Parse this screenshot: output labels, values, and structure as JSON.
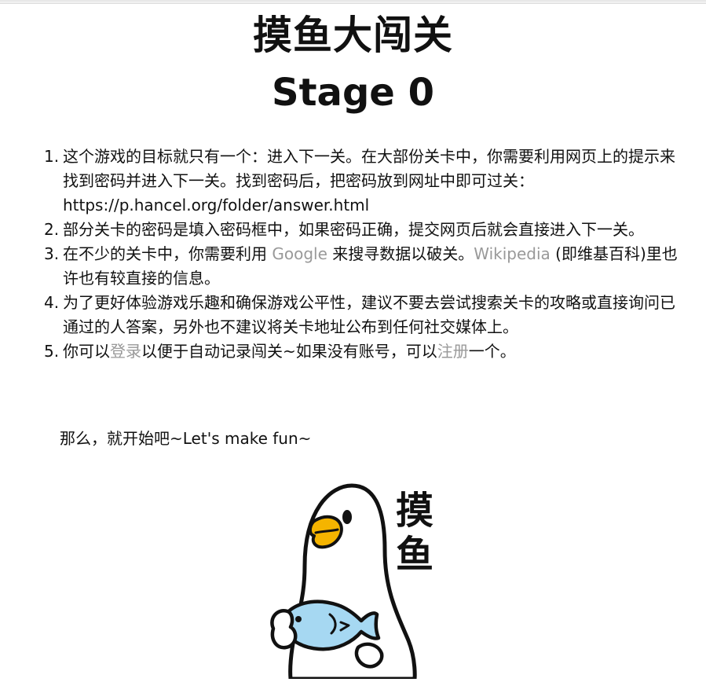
{
  "page": {
    "title": "摸鱼大闯关",
    "stage": "Stage 0"
  },
  "rules": [
    {
      "num": "1.",
      "text": "这个游戏的目标就只有一个：进入下一关。在大部份关卡中，你需要利用网页上的提示来找到密码并进入下一关。找到密码后，把密码放到网址中即可过关：https://p.hancel.org/folder/answer.html"
    },
    {
      "num": "2.",
      "text": "部分关卡的密码是填入密码框中，如果密码正确，提交网页后就会直接进入下一关。"
    },
    {
      "num": "3.",
      "pre": "在不少的关卡中，你需要利用 ",
      "link1": "Google",
      "mid": " 来搜寻数据以破关。",
      "link2": "Wikipedia",
      "post": " (即维基百科)里也许也有较直接的信息。"
    },
    {
      "num": "4.",
      "text": "为了更好体验游戏乐趣和确保游戏公平性，建议不要去尝试搜索关卡的攻略或直接询问已通过的人答案，另外也不建议将关卡地址公布到任何社交媒体上。"
    },
    {
      "num": "5.",
      "pre": "你可以",
      "link1": "登录",
      "mid": "以便于自动记录闯关~如果没有账号，可以",
      "link2": "注册",
      "post": "一个。"
    }
  ],
  "outro": "那么，就开始吧~Let's make fun~",
  "image": {
    "icon": "duck-holding-fish-sticker",
    "caption": "摸鱼",
    "colors": {
      "beak": "#f5b400",
      "fish": "#a6d8f2",
      "outline": "#111111"
    }
  }
}
